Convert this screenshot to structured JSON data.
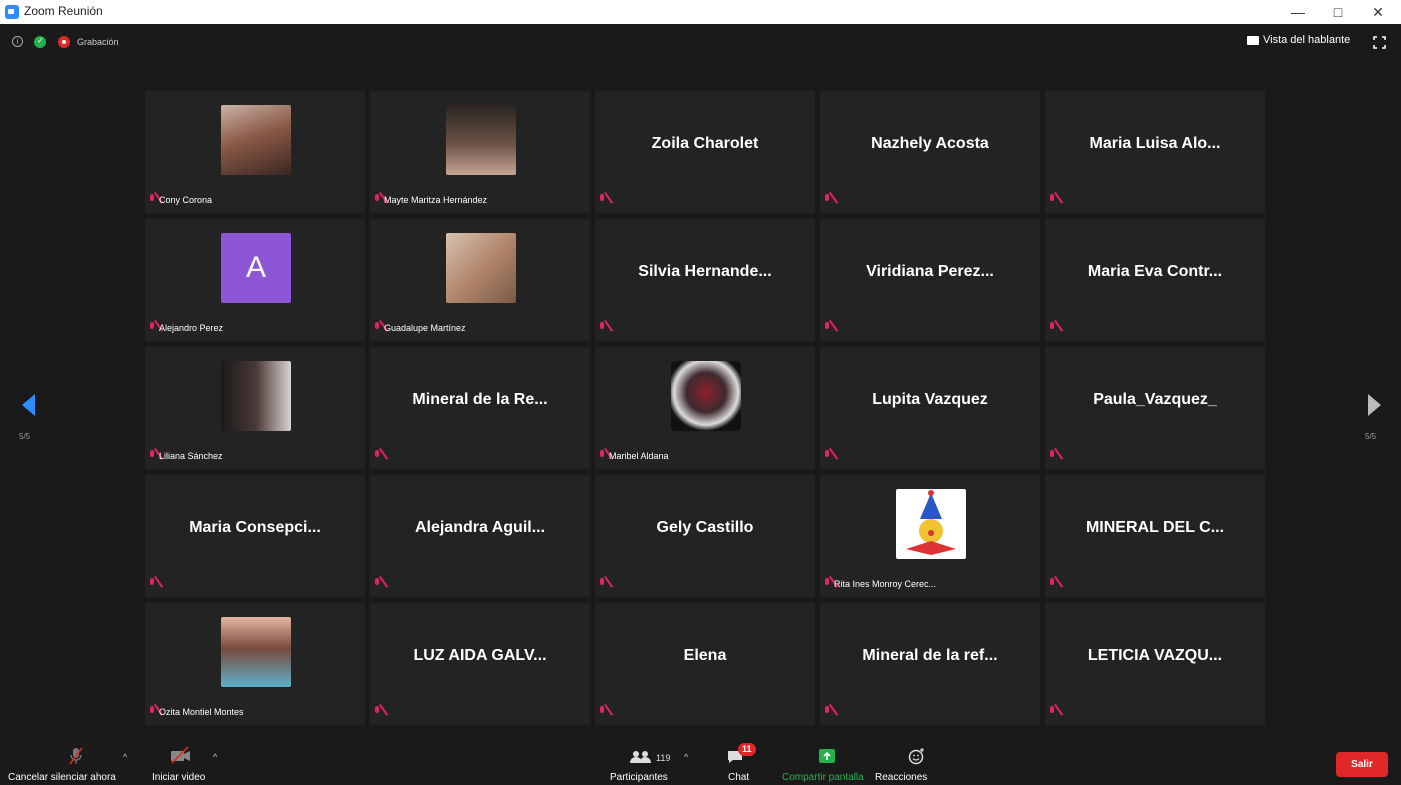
{
  "window": {
    "title": "Zoom Reunión",
    "minimize": "—",
    "maximize": "□",
    "close": "✕"
  },
  "topbar": {
    "recording_label": "Grabación",
    "speaker_view_label": "Vista del hablante"
  },
  "pagination": {
    "left": "5/5",
    "right": "5/5"
  },
  "colors": {
    "accent": "#2d8cff",
    "muted_red": "#e0245e",
    "leave_red": "#e02828",
    "share_green": "#25b14c",
    "tile_bg": "#232323"
  },
  "tiles": [
    {
      "name": "Cony Corona",
      "type": "photo",
      "photo": "woman-selfie"
    },
    {
      "name": "Mayte Maritza Hernández",
      "type": "photo",
      "photo": "woman-hand-face"
    },
    {
      "name": "Zoila Charolet",
      "type": "text"
    },
    {
      "name": "Nazhely Acosta",
      "type": "text"
    },
    {
      "name": "Maria Luisa Alo...",
      "type": "text"
    },
    {
      "name": "Alejandro Perez",
      "type": "avatar",
      "avatar_letter": "A"
    },
    {
      "name": "Guadalupe Martínez",
      "type": "photo",
      "photo": "woman-closeup"
    },
    {
      "name": "Silvia Hernande...",
      "type": "text"
    },
    {
      "name": "Viridiana Perez...",
      "type": "text"
    },
    {
      "name": "Maria Eva Contr...",
      "type": "text"
    },
    {
      "name": "Liliana Sánchez",
      "type": "photo",
      "photo": "woman-portrait-dark"
    },
    {
      "name": "Mineral de la Re...",
      "type": "text"
    },
    {
      "name": "Maribel Aldana",
      "type": "photo",
      "photo": "woman-round-frame"
    },
    {
      "name": "Lupita Vazquez",
      "type": "text"
    },
    {
      "name": "Paula_Vazquez_",
      "type": "text"
    },
    {
      "name": "Maria Consepci...",
      "type": "text"
    },
    {
      "name": "Alejandra Aguil...",
      "type": "text"
    },
    {
      "name": "Gely Castillo",
      "type": "text"
    },
    {
      "name": "Rita Ines Monroy Cerec...",
      "type": "photo",
      "photo": "clown-drawing"
    },
    {
      "name": "MINERAL DEL C...",
      "type": "text"
    },
    {
      "name": "Ozita Montiel Montes",
      "type": "photo",
      "photo": "woman-glasses"
    },
    {
      "name": "LUZ AIDA GALV...",
      "type": "text"
    },
    {
      "name": "Elena",
      "type": "text"
    },
    {
      "name": "Mineral de la ref...",
      "type": "text"
    },
    {
      "name": "LETICIA VAZQU...",
      "type": "text"
    }
  ],
  "toolbar": {
    "unmute_label": "Cancelar silenciar ahora",
    "video_label": "Iniciar video",
    "participants_label": "Participantes",
    "participants_count": "119",
    "chat_label": "Chat",
    "chat_badge": "11",
    "share_label": "Compartir pantalla",
    "reactions_label": "Reacciones",
    "leave_label": "Salir"
  }
}
